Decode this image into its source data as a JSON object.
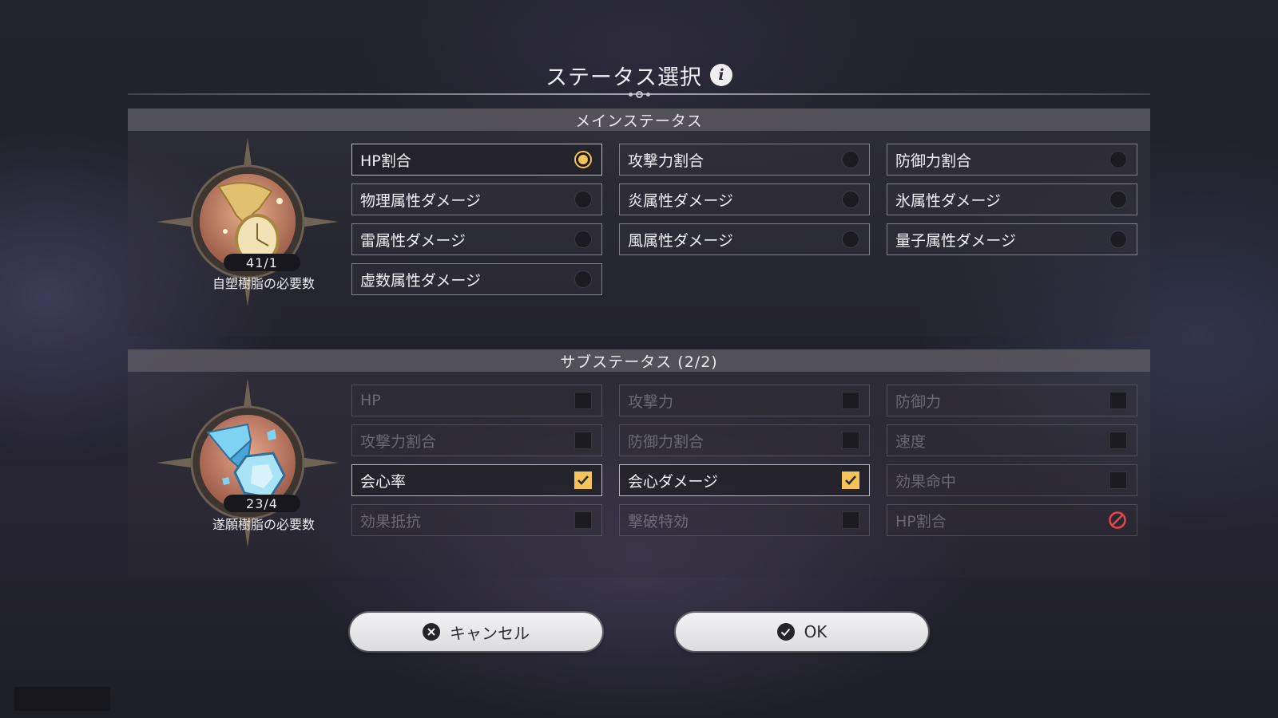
{
  "dialog": {
    "title": "ステータス選択",
    "info_icon": "info-icon"
  },
  "main_stats": {
    "header": "メインステータス",
    "emblem_icon": "golden-hourglass-icon",
    "count": "41/1",
    "cost_label": "自塑樹脂の必要数",
    "options": [
      {
        "label": "HP割合",
        "state": "selected"
      },
      {
        "label": "攻撃力割合",
        "state": "unselected"
      },
      {
        "label": "防御力割合",
        "state": "unselected"
      },
      {
        "label": "物理属性ダメージ",
        "state": "unselected"
      },
      {
        "label": "炎属性ダメージ",
        "state": "unselected"
      },
      {
        "label": "氷属性ダメージ",
        "state": "unselected"
      },
      {
        "label": "雷属性ダメージ",
        "state": "unselected"
      },
      {
        "label": "風属性ダメージ",
        "state": "unselected"
      },
      {
        "label": "量子属性ダメージ",
        "state": "unselected"
      },
      {
        "label": "虚数属性ダメージ",
        "state": "unselected"
      }
    ]
  },
  "sub_stats": {
    "header": "サブステータス (2/2)",
    "emblem_icon": "blue-crystal-icon",
    "count": "23/4",
    "cost_label": "遂願樹脂の必要数",
    "options": [
      {
        "label": "HP",
        "state": "disabled"
      },
      {
        "label": "攻撃力",
        "state": "disabled"
      },
      {
        "label": "防御力",
        "state": "disabled"
      },
      {
        "label": "攻撃力割合",
        "state": "disabled"
      },
      {
        "label": "防御力割合",
        "state": "disabled"
      },
      {
        "label": "速度",
        "state": "disabled"
      },
      {
        "label": "会心率",
        "state": "checked"
      },
      {
        "label": "会心ダメージ",
        "state": "checked"
      },
      {
        "label": "効果命中",
        "state": "disabled"
      },
      {
        "label": "効果抵抗",
        "state": "disabled"
      },
      {
        "label": "撃破特効",
        "state": "disabled"
      },
      {
        "label": "HP割合",
        "state": "blocked"
      }
    ]
  },
  "buttons": {
    "cancel_label": "キャンセル",
    "cancel_icon": "x-circle-icon",
    "ok_label": "OK",
    "ok_icon": "check-circle-icon"
  },
  "colors": {
    "accent": "#f5c35a",
    "blocked": "#e8454a"
  }
}
